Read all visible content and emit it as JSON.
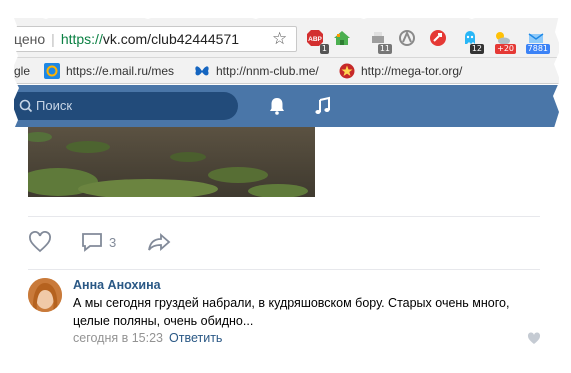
{
  "browser": {
    "url_prefix": "цено",
    "url_scheme": "https://",
    "url_host": "vk.com/club42444571",
    "extensions": [
      {
        "icon": "adblock-icon",
        "label": "ABP",
        "badge": "1",
        "badge_color": "#555555"
      },
      {
        "icon": "home-icon",
        "badge": ""
      },
      {
        "icon": "printer-icon",
        "badge": "11",
        "badge_color": "#777777"
      },
      {
        "icon": "arch-icon",
        "badge": ""
      },
      {
        "icon": "rocket-icon",
        "badge": ""
      },
      {
        "icon": "ghost-icon",
        "badge": "12",
        "badge_color": "#333333"
      },
      {
        "icon": "weather-icon",
        "badge": "+20",
        "badge_color": "#e53935"
      },
      {
        "icon": "mail-icon",
        "badge": "7881",
        "badge_color": "#3b82f6"
      }
    ]
  },
  "bookmarks": [
    {
      "label": "gle",
      "icon": "google-icon"
    },
    {
      "label": "https://e.mail.ru/mes",
      "icon": "mailru-icon"
    },
    {
      "label": "http://nnm-club.me/",
      "icon": "butterfly-icon"
    },
    {
      "label": "http://mega-tor.org/",
      "icon": "star-icon"
    }
  ],
  "vk": {
    "search_placeholder": "Поиск",
    "brand_color": "#4a76a8"
  },
  "post": {
    "comments_count": "3"
  },
  "comment": {
    "author": "Анна Анохина",
    "text": "А мы сегодня груздей набрали, в кудряшовском бору. Старых очень много, целые поляны, очень обидно...",
    "time": "сегодня в 15:23",
    "reply_label": "Ответить"
  }
}
